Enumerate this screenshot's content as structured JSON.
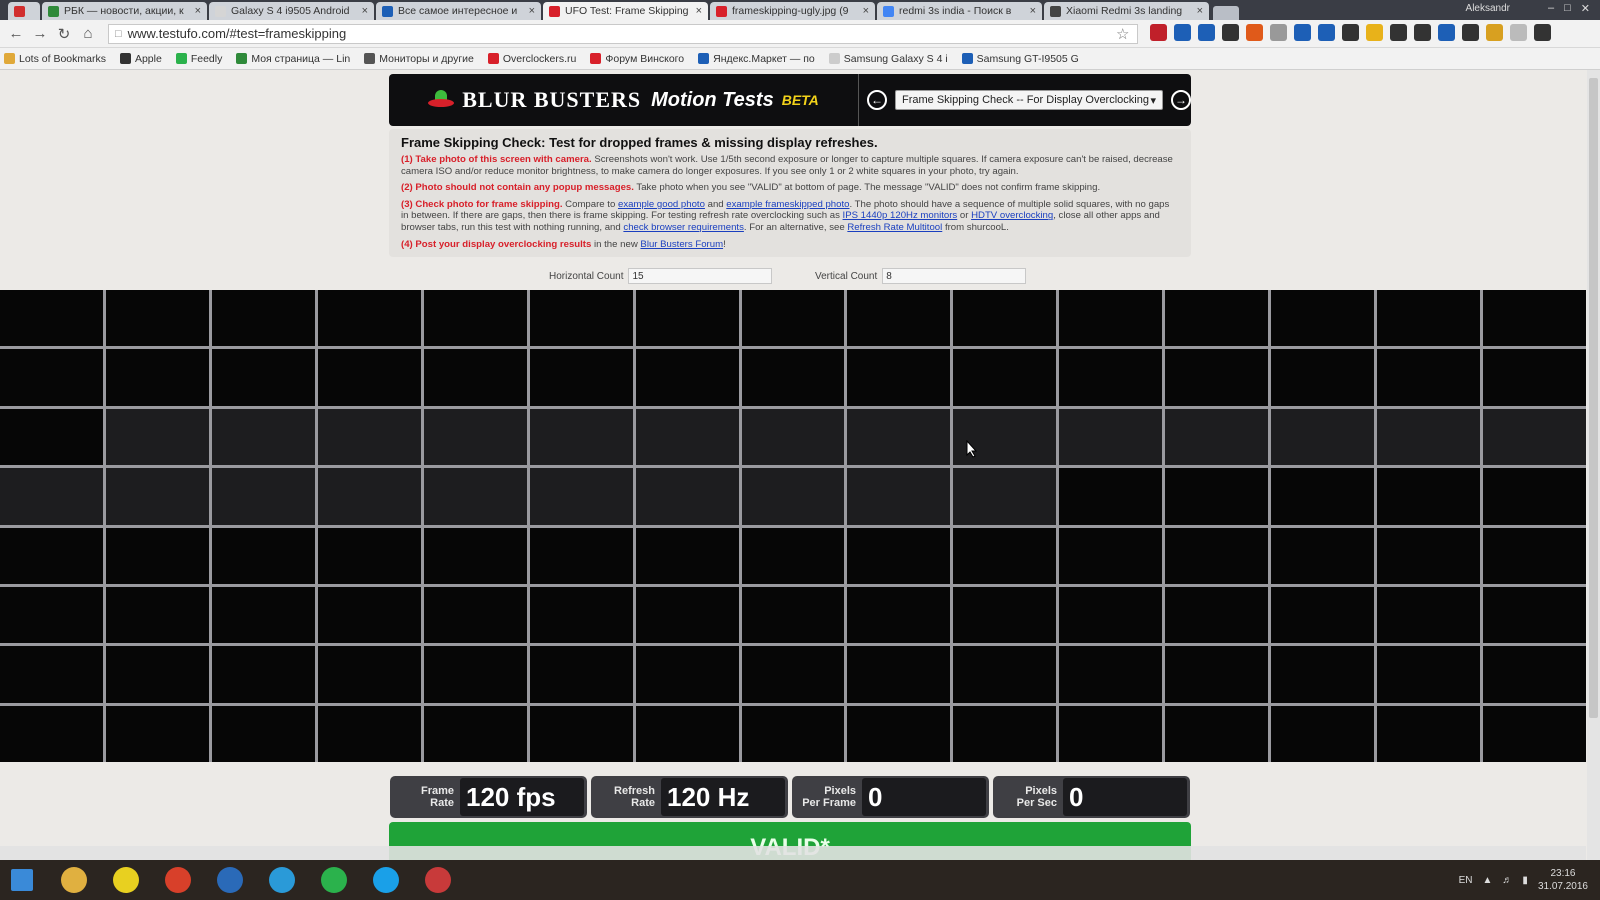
{
  "browser": {
    "tabs": [
      {
        "label": "",
        "color": "#d12e2e",
        "active": false
      },
      {
        "label": "РБК — новости, акции, к",
        "color": "#2f8a3a",
        "active": false
      },
      {
        "label": "Galaxy S 4 i9505 Android",
        "color": "#d5d5d5",
        "active": false
      },
      {
        "label": "Все самое интересное и",
        "color": "#1d5fb6",
        "active": false
      },
      {
        "label": "UFO Test: Frame Skipping",
        "color": "#d8202a",
        "active": true
      },
      {
        "label": "frameskipping-ugly.jpg (9",
        "color": "#d8202a",
        "active": false
      },
      {
        "label": "redmi 3s india - Поиск в",
        "color": "#4285f4",
        "active": false
      },
      {
        "label": "Xiaomi Redmi 3s landing",
        "color": "#444444",
        "active": false
      }
    ],
    "user": "Aleksandr",
    "url": "www.testufo.com/#test=frameskipping",
    "bookmarks": [
      {
        "label": "Lots of Bookmarks",
        "color": "#e0a93a"
      },
      {
        "label": "Apple",
        "color": "#333333"
      },
      {
        "label": "Feedly",
        "color": "#2bb24c"
      },
      {
        "label": "Моя страница — Lin",
        "color": "#2f8a3a"
      },
      {
        "label": "Мониторы и другие",
        "color": "#555555"
      },
      {
        "label": "Overclockers.ru",
        "color": "#d8202a"
      },
      {
        "label": "Форум Винского",
        "color": "#d8202a"
      },
      {
        "label": "Яндекс.Маркет — по",
        "color": "#1d5fb6"
      },
      {
        "label": "Samsung Galaxy S 4 i",
        "color": "#cccccc"
      },
      {
        "label": "Samsung GT-I9505 G",
        "color": "#1d5fb6"
      }
    ]
  },
  "header": {
    "brand_main": "BLUR BUSTERS",
    "brand_sub": "Motion Tests",
    "brand_tag": "BETA",
    "select_value": "Frame Skipping Check -- For Display Overclocking"
  },
  "info": {
    "title": "Frame Skipping Check: Test for dropped frames & missing display refreshes.",
    "step1_red": "(1) Take photo of this screen with camera.",
    "step1_text": " Screenshots won't work. Use 1/5th second exposure or longer to capture multiple squares. If camera exposure can't be raised, decrease camera ISO and/or reduce monitor brightness, to make camera do longer exposures. If you see only 1 or 2 white squares in your photo, try again.",
    "step2_red": "(2) Photo should not contain any popup messages.",
    "step2_text": " Take photo when you see \"VALID\" at bottom of page. The message \"VALID\" does not confirm frame skipping.",
    "step3_red": "(3) Check photo for frame skipping.",
    "step3_a": " Compare to ",
    "step3_link1": "example good photo",
    "step3_b": " and ",
    "step3_link2": "example frameskipped photo",
    "step3_c": ". The photo should have a sequence of multiple solid squares, with no gaps in between. If there are gaps, then there is frame skipping. For testing refresh rate overclocking such as ",
    "step3_link3": "IPS 1440p 120Hz monitors",
    "step3_d": " or ",
    "step3_link4": "HDTV overclocking",
    "step3_e": ", close all other apps and browser tabs, run this test with nothing running, and ",
    "step3_link5": "check browser requirements",
    "step3_f": ". For an alternative, see ",
    "step3_link6": "Refresh Rate Multitool",
    "step3_g": " from shurcooL.",
    "step4_red": "(4) Post your display overclocking results",
    "step4_a": " in the new ",
    "step4_link": "Blur Busters Forum",
    "step4_b": "!"
  },
  "counts": {
    "horizontal_label": "Horizontal Count",
    "horizontal_value": "15",
    "vertical_label": "Vertical Count",
    "vertical_value": "8"
  },
  "grid": {
    "columns": 15,
    "rows": 8,
    "lit_cells": [
      [
        2,
        1
      ],
      [
        2,
        2
      ],
      [
        2,
        3
      ],
      [
        2,
        4
      ],
      [
        2,
        5
      ],
      [
        2,
        6
      ],
      [
        2,
        7
      ],
      [
        2,
        8
      ],
      [
        2,
        9
      ],
      [
        2,
        10
      ],
      [
        2,
        11
      ],
      [
        2,
        12
      ],
      [
        2,
        13
      ],
      [
        2,
        14
      ],
      [
        3,
        0
      ],
      [
        3,
        1
      ],
      [
        3,
        2
      ],
      [
        3,
        3
      ],
      [
        3,
        4
      ],
      [
        3,
        5
      ],
      [
        3,
        6
      ],
      [
        3,
        7
      ],
      [
        3,
        8
      ],
      [
        3,
        9
      ]
    ]
  },
  "stats": [
    {
      "label1": "Frame",
      "label2": "Rate",
      "value": "120 fps"
    },
    {
      "label1": "Refresh",
      "label2": "Rate",
      "value": "120 Hz"
    },
    {
      "label1": "Pixels",
      "label2": "Per Frame",
      "value": "0"
    },
    {
      "label1": "Pixels",
      "label2": "Per Sec",
      "value": "0"
    }
  ],
  "status": "VALID*",
  "taskbar": {
    "language": "EN",
    "time": "23:16",
    "date": "31.07.2016",
    "apps": [
      "windows-start",
      "explorer",
      "help",
      "chrome",
      "thunderbird",
      "telegram",
      "hangouts",
      "skype",
      "app-eye"
    ]
  }
}
